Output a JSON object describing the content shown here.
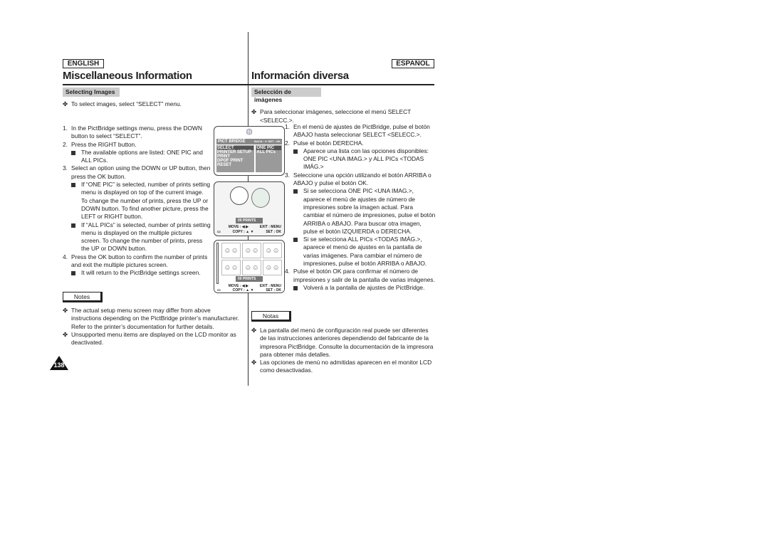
{
  "header": {
    "english": "ENGLISH",
    "espanol": "ESPAÑOL",
    "title_en": "Miscellaneous Information",
    "title_es": "Información diversa"
  },
  "en": {
    "section": "Selecting Images",
    "intro": "To select images, select “SELECT” menu.",
    "steps": [
      {
        "n": "1.",
        "text": "In the PictBridge settings menu, press the DOWN button to select “SELECT”.",
        "subs": []
      },
      {
        "n": "2.",
        "text": "Press the RIGHT button.",
        "subs": [
          "The available options are listed: ONE PIC and ALL PICs."
        ]
      },
      {
        "n": "3.",
        "text": "Select an option using the DOWN or UP button, then press the OK button.",
        "subs": [
          "If “ONE PIC” is selected, number of prints setting menu is displayed on top of the current image. To change the number of prints, press the UP or DOWN button. To find another picture, press the LEFT or RIGHT button.",
          "If “ALL PICs” is selected, number of prints setting menu is displayed on the multiple pictures screen. To change the number of prints, press the UP or DOWN button."
        ]
      },
      {
        "n": "4.",
        "text": "Press the OK button to confirm the number of prints and exit the multiple pictures screen.",
        "subs": [
          "It will return to the PictBridge settings screen."
        ]
      }
    ],
    "notes_label": "Notes",
    "notes": [
      "The actual setup menu screen may differ from above instructions depending on the PictBridge printer’s manufacturer. Refer to the printer’s documentation for further details.",
      "Unsupported menu items are displayed on the LCD monitor as deactivated."
    ]
  },
  "es": {
    "section": "Selección de imágenes",
    "intro": "Para seleccionar imágenes, seleccione el menú SELECT <SELECC.>.",
    "steps": [
      {
        "n": "1.",
        "text": "En el menú de ajustes de PictBridge, pulse el botón ABAJO hasta seleccionar SELECT <SELECC.>.",
        "subs": []
      },
      {
        "n": "2.",
        "text": "Pulse el botón DERECHA.",
        "subs": [
          "Aparece una lista con las opciones disponibles: ONE PIC <UNA IMAG.> y ALL PICs <TODAS IMÁG.>"
        ]
      },
      {
        "n": "3.",
        "text": "Seleccione una opción utilizando el botón ARRIBA o ABAJO y pulse el botón OK.",
        "subs": [
          "Si se selecciona ONE PIC <UNA IMAG.>, aparece el menú de ajustes de número de impresiones sobre la imagen actual. Para cambiar el número de impresiones, pulse el botón ARRIBA o ABAJO. Para buscar otra imagen, pulse el botón IZQUIERDA o DERECHA.",
          "Si se selecciona ALL PICs <TODAS IMÁG.>, aparece el menú de ajustes en la pantalla de varias imágenes. Para cambiar el número de impresiones, pulse el botón ARRIBA o ABAJO."
        ]
      },
      {
        "n": "4.",
        "text": "Pulse el botón OK para confirmar el número de impresiones y salir de la pantalla de varias imágenes.",
        "subs": [
          "Volverá a la pantalla de ajustes de PictBridge."
        ]
      }
    ],
    "notes_label": "Notas",
    "notes": [
      "La pantalla del menú de configuración real puede ser diferentes de las instrucciones anteriores dependiendo del fabricante de la impresora PictBridge. Consulte la documentación de la impresora para obtener más detalles.",
      "Las opciones de menú no admitidas aparecen en el monitor LCD como desactivadas."
    ]
  },
  "lcd": {
    "menu_title": "PICT BRIDGE",
    "menu_back": "BACK : ↩",
    "menu_set": "SET : OK",
    "menu_items": [
      "SELECT",
      "PRINTER SETUP",
      "PRINT",
      "DPOF PRINT",
      "RESET"
    ],
    "menu_options": [
      "ONE PIC",
      "ALL PICs"
    ],
    "prints_count": "00",
    "prints_label": "PRINTS",
    "move": "MOVE : ◀ ▶",
    "exit": "EXIT : MENU",
    "copy": "COPY : ▲ ▼",
    "set": "SET : OK"
  },
  "page_number": "138"
}
